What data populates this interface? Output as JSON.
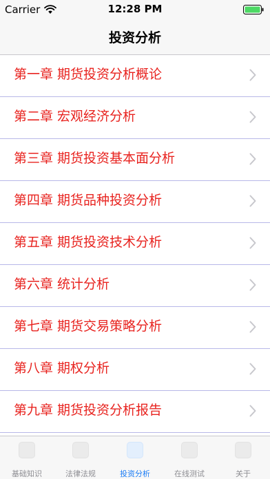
{
  "status_bar": {
    "carrier": "Carrier",
    "time": "12:28 PM"
  },
  "nav": {
    "title": "投资分析"
  },
  "chapters": [
    {
      "label": "第一章 期货投资分析概论"
    },
    {
      "label": "第二章 宏观经济分析"
    },
    {
      "label": "第三章 期货投资基本面分析"
    },
    {
      "label": "第四章 期货品种投资分析"
    },
    {
      "label": "第五章 期货投资技术分析"
    },
    {
      "label": "第六章 统计分析"
    },
    {
      "label": "第七章 期货交易策略分析"
    },
    {
      "label": "第八章 期权分析"
    },
    {
      "label": "第九章 期货投资分析报告"
    }
  ],
  "tabs": [
    {
      "label": "基础知识",
      "active": false
    },
    {
      "label": "法律法规",
      "active": false
    },
    {
      "label": "投资分析",
      "active": true
    },
    {
      "label": "在线测试",
      "active": false
    },
    {
      "label": "关于",
      "active": false
    }
  ],
  "colors": {
    "chapter_text": "#e8231f",
    "row_separator": "#b7b7e8",
    "tab_active": "#1b7cf6",
    "tab_inactive": "#8e8e93",
    "battery_fill": "#4cd964"
  },
  "icons": {
    "wifi": "wifi-icon",
    "battery": "battery-icon",
    "row_disclosure": "chevron-right-icon"
  }
}
